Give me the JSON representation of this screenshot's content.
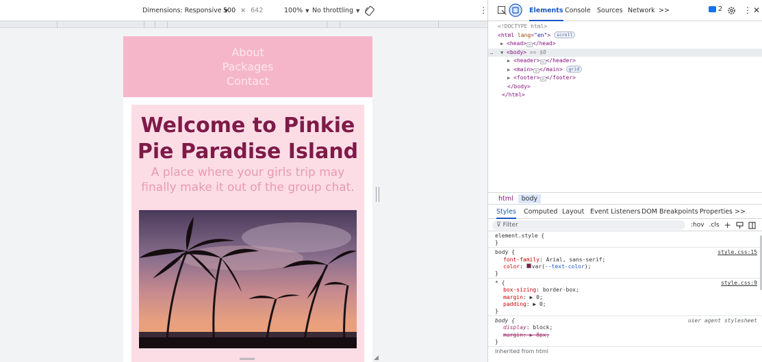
{
  "device_toolbar": {
    "dimensions_label": "Dimensions: Responsive",
    "width_value": "500",
    "times_sign": "×",
    "height_value": "642",
    "zoom_label": "100%",
    "throttling_label": "No throttling"
  },
  "site": {
    "nav": [
      "About",
      "Packages",
      "Contact"
    ],
    "hero_title": "Welcome to Pinkie Pie Paradise Island",
    "hero_subtitle": "A place where your girls trip may finally make it out of the group chat."
  },
  "devtools": {
    "tabs": [
      "Elements",
      "Console",
      "Sources",
      "Network"
    ],
    "more_tabs": ">>",
    "issues_count": "2",
    "dom": {
      "doctype": "<!DOCTYPE html>",
      "html_open": "<html",
      "html_attr_name": "lang",
      "html_attr_value": "\"en\"",
      "html_open_end": ">",
      "scroll_pill": "scroll",
      "head_open": "<head>",
      "head_close": "</head>",
      "body_open": "<body>",
      "body_eq": "== $0",
      "header_open": "<header>",
      "header_close": "</header>",
      "main_open": "<main>",
      "main_close": "</main>",
      "grid_pill": "grid",
      "footer_open": "<footer>",
      "footer_close": "</footer>",
      "body_close": "</body>",
      "html_close": "</html>"
    },
    "breadcrumb": [
      "html",
      "body"
    ],
    "style_tabs": [
      "Styles",
      "Computed",
      "Layout",
      "Event Listeners",
      "DOM Breakpoints",
      "Properties"
    ],
    "style_tabs_more": ">>",
    "filter_placeholder": "Filter",
    "filter_tools": [
      ":hov",
      ".cls",
      "+"
    ],
    "rules": {
      "element_style_selector": "element.style {",
      "close_brace": "}",
      "body_selector": "body {",
      "body_source": "style.css:15",
      "font_family_name": "font-family",
      "font_family_value": "Arial, sans-serif;",
      "color_name": "color",
      "color_value_prefix": "var(",
      "color_value_var": "--text-color",
      "color_value_suffix": ");",
      "star_selector": "* {",
      "star_source": "style.css:9",
      "box_sizing_name": "box-sizing",
      "box_sizing_value": "border-box;",
      "margin_name": "margin",
      "margin_value": "▶ 0;",
      "padding_name": "padding",
      "padding_value": "▶ 0;",
      "ua_selector": "body {",
      "ua_source": "user agent stylesheet",
      "display_name": "display",
      "display_value": "block;",
      "ua_margin": "margin: ▶ 8px;",
      "inherited_label": "Inherited from html"
    }
  },
  "colors": {
    "header_pink": "#f6b6c9",
    "main_pink": "#fcdde6",
    "title_maroon": "#7e1a48",
    "subtitle_pink": "#e89ab1",
    "devtools_accent": "#1a56c4"
  }
}
